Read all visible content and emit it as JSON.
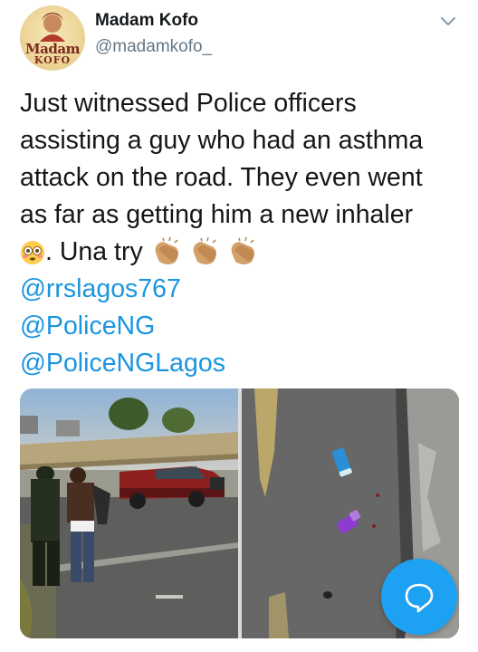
{
  "author": {
    "display_name": "Madam Kofo",
    "handle": "@madamkofo_",
    "avatar_text_line1": "Madam",
    "avatar_text_line2": "KOFO"
  },
  "tweet": {
    "lines": [
      "Just witnessed Police officers",
      "assisting a guy who had an asthma",
      "attack on the road. They even went",
      "as far as getting him a new inhaler"
    ],
    "line5_text": ". Una try",
    "mentions": [
      "@rrslagos767",
      "@PoliceNG",
      "@PoliceNGLagos"
    ]
  },
  "icons": {
    "more": "chevron-down-icon",
    "flushed_emoji": "flushed-face-emoji",
    "clap_emoji": "clapping-hands-emoji",
    "fab": "chat-bubble-icon"
  },
  "colors": {
    "link": "#1b95e0",
    "muted": "#657786",
    "fab": "#1da1f2"
  }
}
